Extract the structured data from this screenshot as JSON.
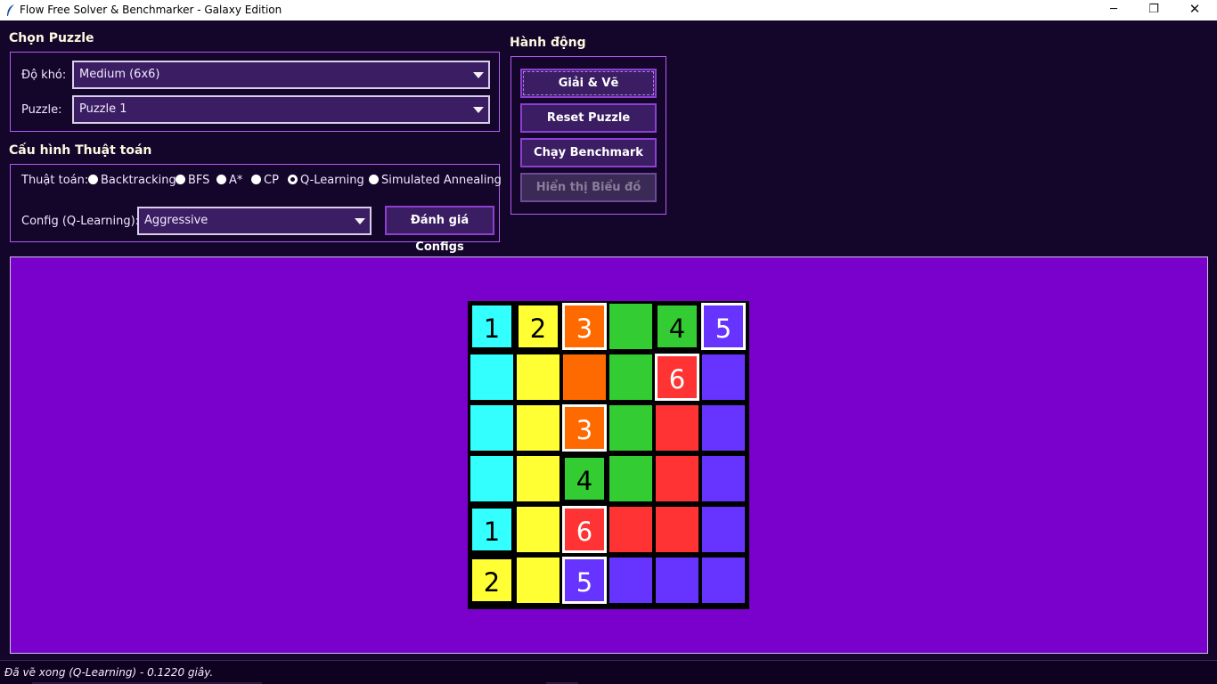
{
  "window": {
    "title": "Flow Free Solver & Benchmarker - Galaxy Edition",
    "min_glyph": "─",
    "max_glyph": "❐",
    "close_glyph": "✕",
    "app_icon": "feather-icon"
  },
  "select_puzzle": {
    "title": "Chọn Puzzle",
    "difficulty_label": "Độ khó:",
    "difficulty_value": "Medium (6x6)",
    "puzzle_label": "Puzzle:",
    "puzzle_value": "Puzzle 1"
  },
  "algorithm_config": {
    "title": "Cấu hình Thuật toán",
    "algorithm_label": "Thuật toán:",
    "options": [
      "Backtracking",
      "BFS",
      "A*",
      "CP",
      "Q-Learning",
      "Simulated Annealing"
    ],
    "selected": "Q-Learning",
    "config_label": "Config (Q-Learning):",
    "config_value": "Aggressive",
    "evaluate_button": "Đánh giá Configs"
  },
  "actions": {
    "title": "Hành động",
    "solve_button": "Giải & Vẽ",
    "reset_button": "Reset Puzzle",
    "benchmark_button": "Chạy Benchmark Suite",
    "chart_button": "Hiển thị Biểu đồ",
    "chart_button_disabled": true
  },
  "colors": {
    "cyan": "#33ffff",
    "yellow": "#ffff33",
    "orange": "#ff6a00",
    "green": "#33cc33",
    "red": "#ff3333",
    "violet": "#6633ff",
    "canvas_bg": "#7a00cc"
  },
  "board": {
    "size": 6,
    "cells": [
      [
        {
          "color": "cyan",
          "label": "1"
        },
        {
          "color": "yellow",
          "label": "2"
        },
        {
          "color": "orange",
          "label": "3"
        },
        {
          "color": "green",
          "label": ""
        },
        {
          "color": "green",
          "label": "4"
        },
        {
          "color": "violet",
          "label": "5"
        }
      ],
      [
        {
          "color": "cyan",
          "label": ""
        },
        {
          "color": "yellow",
          "label": ""
        },
        {
          "color": "orange",
          "label": ""
        },
        {
          "color": "green",
          "label": ""
        },
        {
          "color": "red",
          "label": "6"
        },
        {
          "color": "violet",
          "label": ""
        }
      ],
      [
        {
          "color": "cyan",
          "label": ""
        },
        {
          "color": "yellow",
          "label": ""
        },
        {
          "color": "orange",
          "label": "3"
        },
        {
          "color": "green",
          "label": ""
        },
        {
          "color": "red",
          "label": ""
        },
        {
          "color": "violet",
          "label": ""
        }
      ],
      [
        {
          "color": "cyan",
          "label": ""
        },
        {
          "color": "yellow",
          "label": ""
        },
        {
          "color": "green",
          "label": "4"
        },
        {
          "color": "green",
          "label": ""
        },
        {
          "color": "red",
          "label": ""
        },
        {
          "color": "violet",
          "label": ""
        }
      ],
      [
        {
          "color": "cyan",
          "label": "1"
        },
        {
          "color": "yellow",
          "label": ""
        },
        {
          "color": "red",
          "label": "6"
        },
        {
          "color": "red",
          "label": ""
        },
        {
          "color": "red",
          "label": ""
        },
        {
          "color": "violet",
          "label": ""
        }
      ],
      [
        {
          "color": "yellow",
          "label": "2"
        },
        {
          "color": "yellow",
          "label": ""
        },
        {
          "color": "violet",
          "label": "5"
        },
        {
          "color": "violet",
          "label": ""
        },
        {
          "color": "violet",
          "label": ""
        },
        {
          "color": "violet",
          "label": ""
        }
      ]
    ]
  },
  "status": {
    "text": "Đã vẽ xong (Q-Learning) - 0.1220 giây."
  }
}
